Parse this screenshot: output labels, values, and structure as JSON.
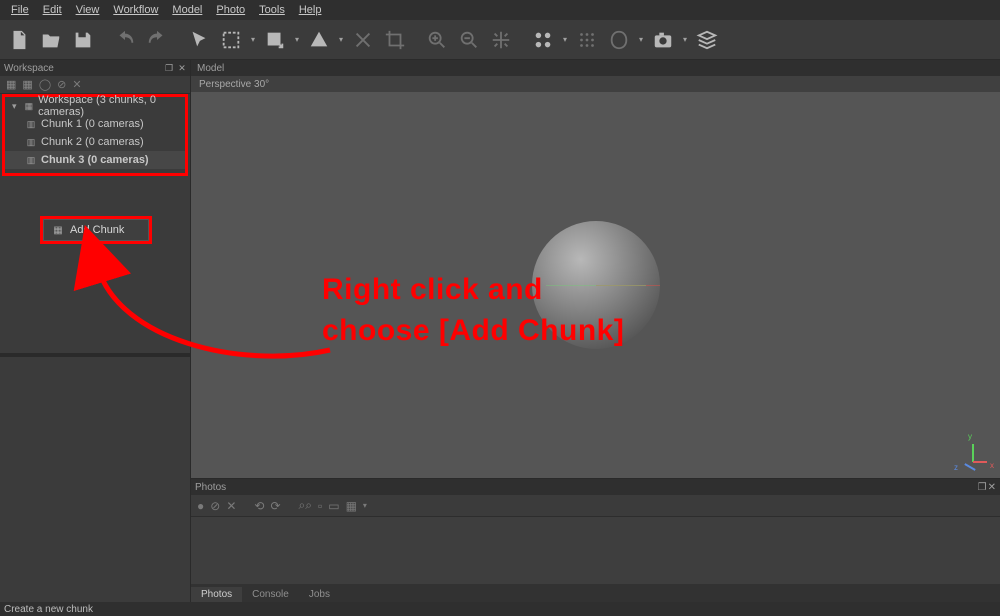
{
  "menu": {
    "items": [
      "File",
      "Edit",
      "View",
      "Workflow",
      "Model",
      "Photo",
      "Tools",
      "Help"
    ],
    "underline_idx": [
      0,
      0,
      0,
      0,
      0,
      0,
      0,
      0
    ]
  },
  "panels": {
    "workspace_title": "Workspace",
    "model_title": "Model",
    "viewport_label": "Perspective 30°",
    "photos_title": "Photos",
    "tabs": [
      "Photos",
      "Console",
      "Jobs"
    ],
    "active_tab": 0
  },
  "tree": {
    "root": "Workspace (3 chunks, 0 cameras)",
    "items": [
      {
        "label": "Chunk 1 (0 cameras)",
        "selected": false
      },
      {
        "label": "Chunk 2 (0 cameras)",
        "selected": false
      },
      {
        "label": "Chunk 3 (0 cameras)",
        "selected": true
      }
    ]
  },
  "context_menu": {
    "add_chunk": "Add Chunk"
  },
  "status": {
    "text": "Create a new chunk"
  },
  "annotation": {
    "line1": "Right click and",
    "line2": "choose [Add Chunk]"
  },
  "axis": {
    "x": "x",
    "y": "y",
    "z": "z"
  }
}
